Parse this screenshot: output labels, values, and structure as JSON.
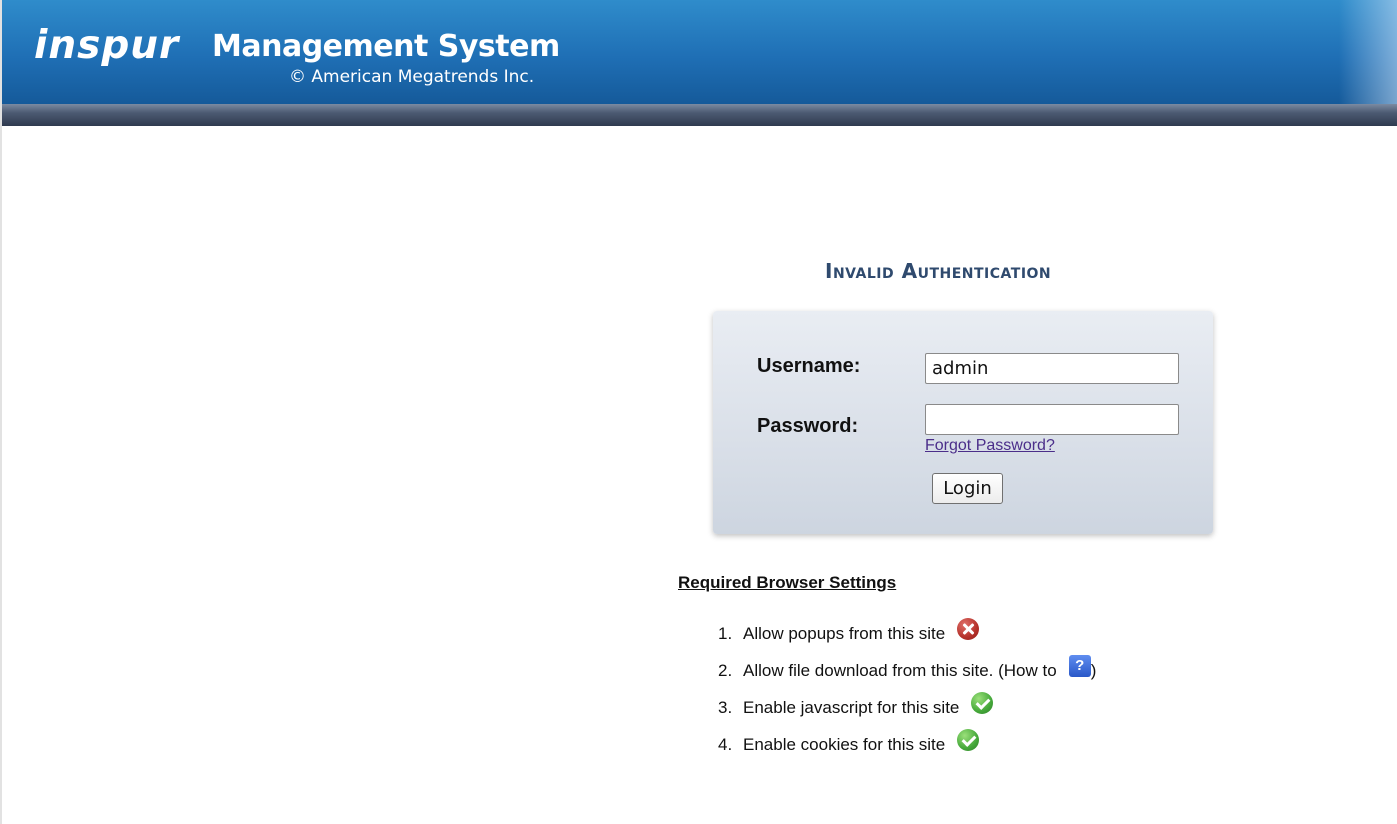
{
  "header": {
    "logo_text": "inspur",
    "title": "Management System",
    "subtitle": "© American Megatrends Inc."
  },
  "login": {
    "heading": "Invalid Authentication",
    "username_label": "Username:",
    "username_value": "admin",
    "password_label": "Password:",
    "password_value": "",
    "forgot_link": "Forgot Password?",
    "login_button": "Login"
  },
  "browser_settings": {
    "title": "Required Browser Settings",
    "items": [
      {
        "number": "1.",
        "text": "Allow popups from this site",
        "status_icon": "error-x-icon"
      },
      {
        "number": "2.",
        "text": "Allow file download from this site. (How to",
        "help_icon": "help-icon",
        "help_glyph": "?",
        "suffix": ")"
      },
      {
        "number": "3.",
        "text": "Enable javascript for this site",
        "status_icon": "check-icon"
      },
      {
        "number": "4.",
        "text": "Enable cookies for this site",
        "status_icon": "check-icon"
      }
    ]
  },
  "colors": {
    "header_top": "#2f8ccb",
    "header_bottom": "#155a9a",
    "band": "#3a4760",
    "heading_text": "#2f4a6e",
    "login_box": "#dde3eb",
    "link": "#4b2e8a",
    "error": "#b5312a",
    "success": "#45a83a",
    "help": "#2a58c8"
  }
}
